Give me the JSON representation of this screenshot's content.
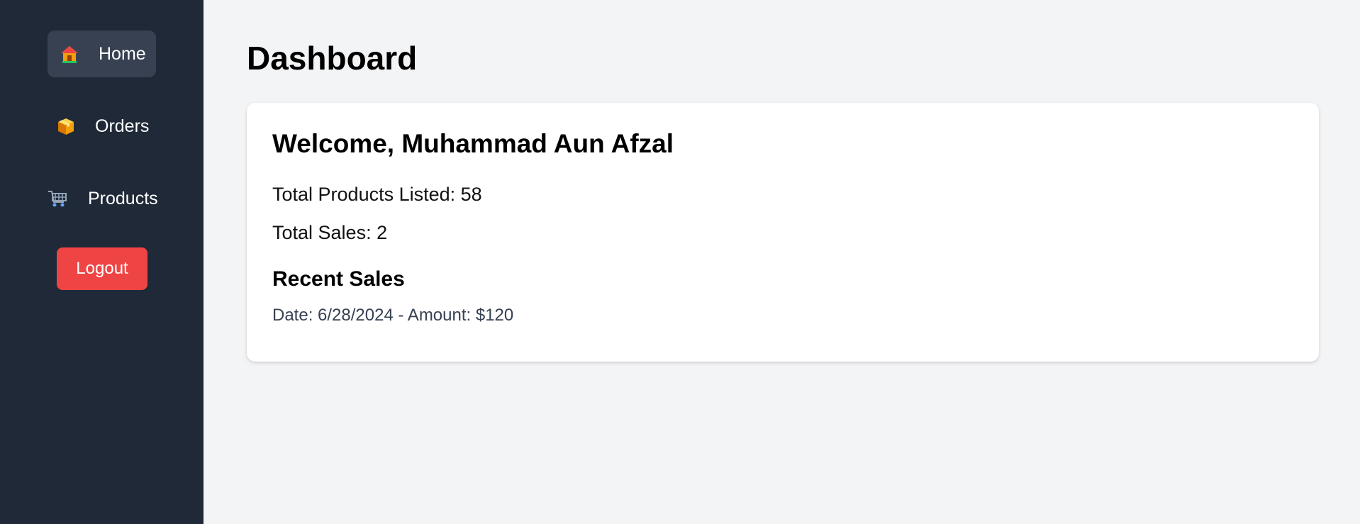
{
  "sidebar": {
    "items": [
      {
        "label": "Home",
        "icon": "house-icon",
        "active": true
      },
      {
        "label": "Orders",
        "icon": "package-icon",
        "active": false
      },
      {
        "label": "Products",
        "icon": "shopping-cart-icon",
        "active": false
      }
    ],
    "logout_label": "Logout"
  },
  "main": {
    "title": "Dashboard",
    "card": {
      "welcome": "Welcome, Muhammad Aun Afzal",
      "total_products": "Total Products Listed: 58",
      "total_sales": "Total Sales: 2",
      "recent_sales_title": "Recent Sales",
      "recent_sales": [
        {
          "text": "Date: 6/28/2024 - Amount: $120"
        }
      ]
    }
  },
  "colors": {
    "sidebar_bg": "#1f2937",
    "active_item_bg": "#374151",
    "logout_bg": "#ef4444",
    "page_bg": "#f3f4f6",
    "card_bg": "#ffffff"
  }
}
